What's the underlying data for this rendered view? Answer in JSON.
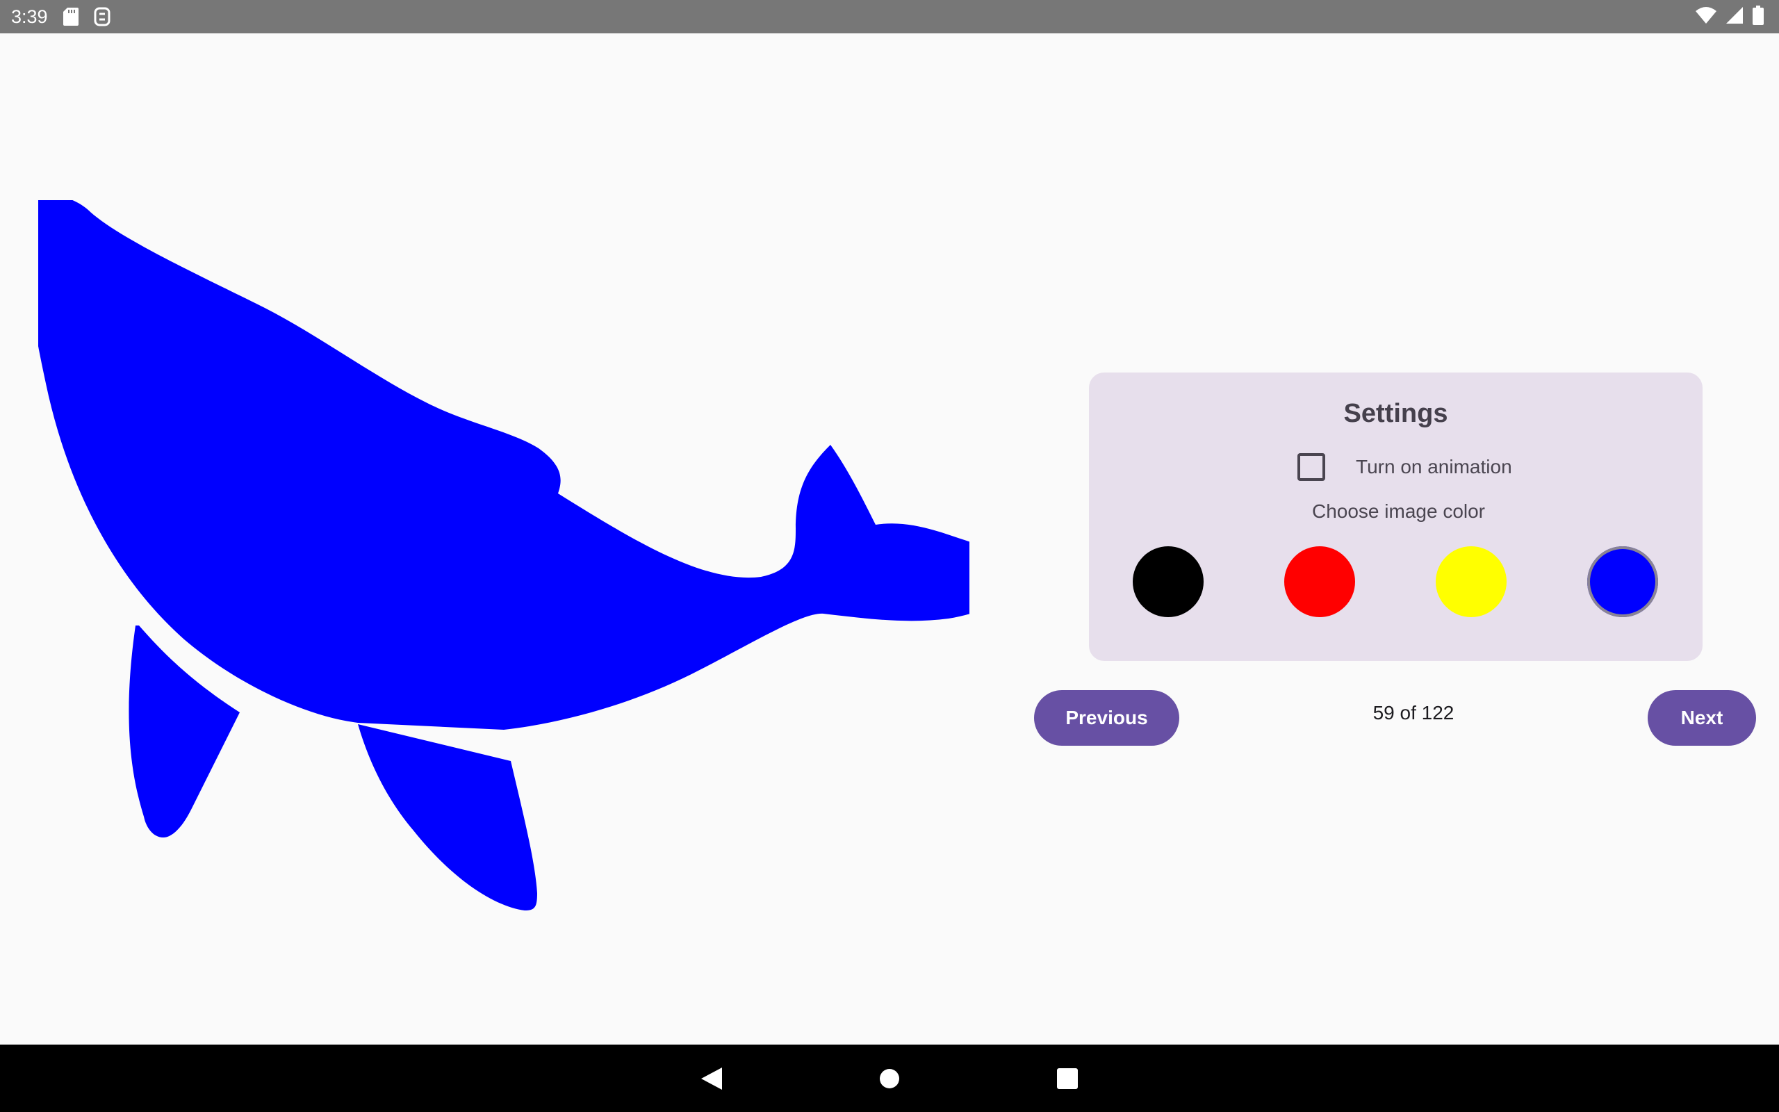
{
  "status_bar": {
    "time": "3:39",
    "left_icons": [
      "sd-card-icon",
      "sync-icon"
    ],
    "right_icons": [
      "wifi-icon",
      "signal-icon",
      "battery-icon"
    ]
  },
  "image": {
    "subject": "whale-silhouette",
    "fill_color": "#0000ff"
  },
  "settings": {
    "title": "Settings",
    "animation_label": "Turn on animation",
    "animation_checked": false,
    "color_label": "Choose image color",
    "colors": [
      {
        "name": "black",
        "hex": "#000000",
        "selected": false
      },
      {
        "name": "red",
        "hex": "#ff0000",
        "selected": false
      },
      {
        "name": "yellow",
        "hex": "#ffff00",
        "selected": false
      },
      {
        "name": "blue",
        "hex": "#0000ff",
        "selected": true
      }
    ]
  },
  "navigation": {
    "previous_label": "Previous",
    "next_label": "Next",
    "counter": "59 of 122"
  },
  "system_nav": [
    "back-icon",
    "home-icon",
    "recents-icon"
  ],
  "theme": {
    "accent": "#6750a4",
    "card_background": "#e7dfec",
    "status_bar": "#777777",
    "nav_bar": "#000000"
  }
}
